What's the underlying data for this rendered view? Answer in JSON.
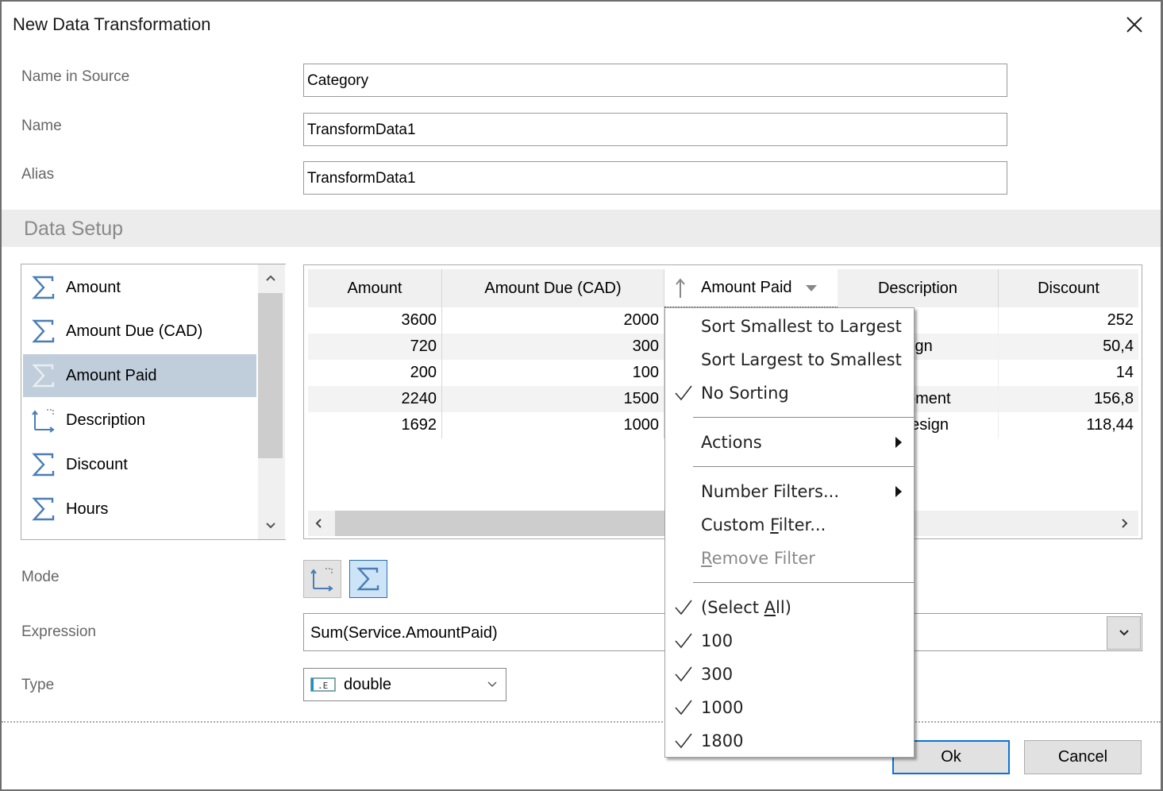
{
  "dialog": {
    "title": "New Data Transformation",
    "close_icon": "close-icon"
  },
  "form": {
    "name_in_source": {
      "label": "Name in Source",
      "value": "Category"
    },
    "name": {
      "label": "Name",
      "value": "TransformData1"
    },
    "alias": {
      "label": "Alias",
      "value": "TransformData1"
    }
  },
  "section": {
    "title": "Data Setup"
  },
  "fields": {
    "items": [
      {
        "label": "Amount",
        "icon": "sigma-icon",
        "selected": false
      },
      {
        "label": "Amount Due (CAD)",
        "icon": "sigma-icon",
        "selected": false
      },
      {
        "label": "Amount Paid",
        "icon": "sigma-icon",
        "selected": true
      },
      {
        "label": "Description",
        "icon": "dimension-icon",
        "selected": false
      },
      {
        "label": "Discount",
        "icon": "sigma-icon",
        "selected": false
      },
      {
        "label": "Hours",
        "icon": "sigma-icon",
        "selected": false
      }
    ]
  },
  "grid": {
    "columns": [
      "Amount",
      "Amount Due (CAD)",
      "Amount Paid",
      "Description",
      "Discount"
    ],
    "rows": [
      {
        "amount": "3600",
        "amount_due": "2000",
        "description": "",
        "discount": "252"
      },
      {
        "amount": "720",
        "amount_due": "300",
        "description": "ign",
        "discount": "50,4"
      },
      {
        "amount": "200",
        "amount_due": "100",
        "description": "",
        "discount": "14"
      },
      {
        "amount": "2240",
        "amount_due": "1500",
        "description": "pment",
        "discount": "156,8"
      },
      {
        "amount": "1692",
        "amount_due": "1000",
        "description": "design",
        "discount": "118,44"
      }
    ]
  },
  "menu": {
    "sort_asc": "Sort Smallest to Largest",
    "sort_desc": "Sort Largest to Smallest",
    "no_sort": "No Sorting",
    "actions": "Actions",
    "number_filters": "Number Filters...",
    "custom_filter_pre": "Custom ",
    "custom_filter_u": "F",
    "custom_filter_post": "ilter...",
    "remove_filter_u": "R",
    "remove_filter_post": "emove Filter",
    "select_all_pre": "(Select ",
    "select_all_u": "A",
    "select_all_post": "ll)",
    "values": [
      "100",
      "300",
      "1000",
      "1800"
    ]
  },
  "mode": {
    "label": "Mode",
    "active": "sum"
  },
  "expression": {
    "label": "Expression",
    "value": "Sum(Service.AmountPaid)"
  },
  "type": {
    "label": "Type",
    "value": "double"
  },
  "buttons": {
    "ok": "Ok",
    "cancel": "Cancel"
  },
  "colors": {
    "accent": "#0a74d6",
    "selection": "#c0cedb",
    "icon": "#4a7db5"
  }
}
